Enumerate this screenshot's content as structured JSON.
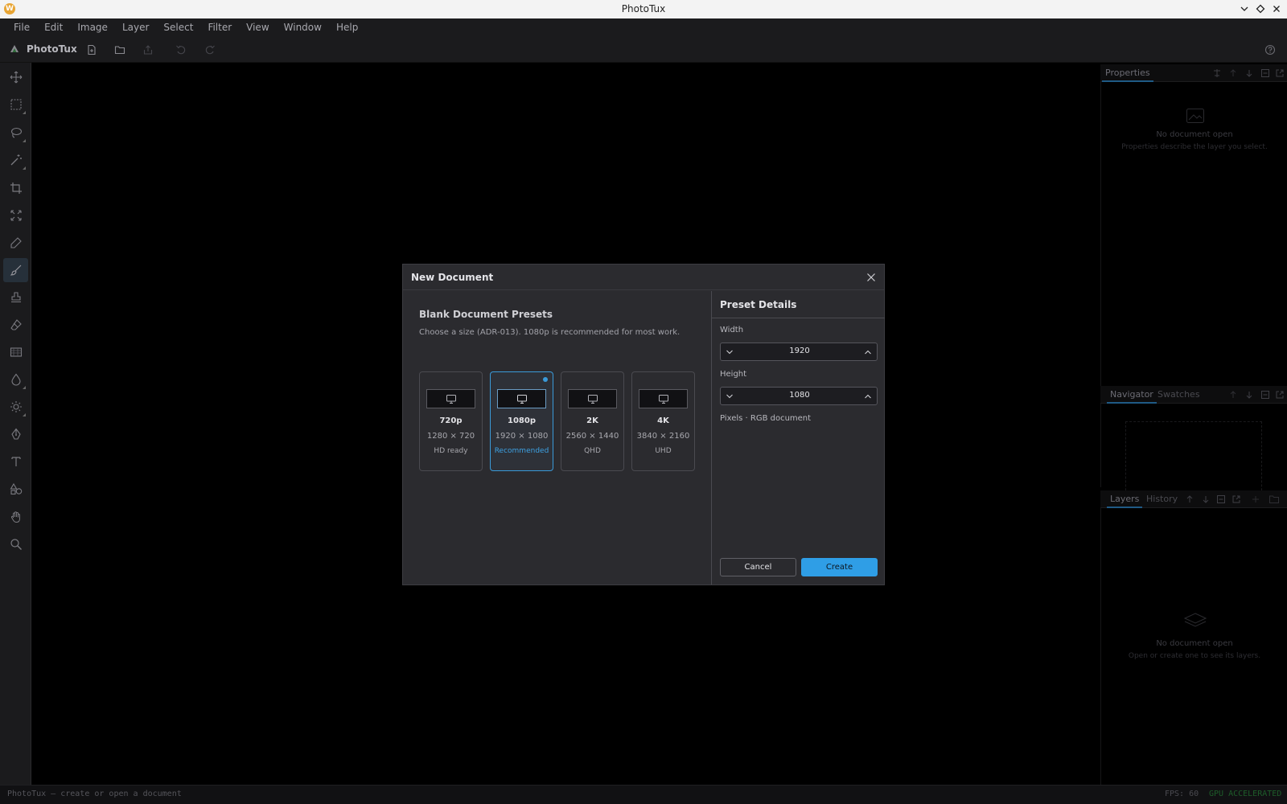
{
  "window": {
    "title": "PhotoTux",
    "logo_letter": "W"
  },
  "menu": [
    "File",
    "Edit",
    "Image",
    "Layer",
    "Select",
    "Filter",
    "View",
    "Window",
    "Help"
  ],
  "toolbar": {
    "brand": "PhotoTux"
  },
  "panels": {
    "properties": {
      "tab": "Properties",
      "empty_title": "No document open",
      "empty_sub": "Properties describe the layer you select."
    },
    "navigator": {
      "tabs": [
        "Navigator",
        "Swatches"
      ]
    },
    "layers": {
      "tabs": [
        "Layers",
        "History"
      ],
      "empty_title": "No document open",
      "empty_sub": "Open or create one to see its layers."
    }
  },
  "status": {
    "left": "PhotoTux — create or open a document",
    "fps": "FPS: 60",
    "gpu": "GPU ACCELERATED"
  },
  "dialog": {
    "title": "New Document",
    "presets_heading": "Blank Document Presets",
    "presets_desc": "Choose a size (ADR-013). 1080p is recommended for most work.",
    "presets": [
      {
        "name": "720p",
        "dims": "1280 × 720",
        "tag": "HD ready",
        "selected": false
      },
      {
        "name": "1080p",
        "dims": "1920 × 1080",
        "tag": "Recommended",
        "selected": true
      },
      {
        "name": "2K",
        "dims": "2560 × 1440",
        "tag": "QHD",
        "selected": false
      },
      {
        "name": "4K",
        "dims": "3840 × 2160",
        "tag": "UHD",
        "selected": false
      }
    ],
    "details": {
      "heading": "Preset Details",
      "width_label": "Width",
      "width_value": "1920",
      "height_label": "Height",
      "height_value": "1080",
      "note": "Pixels · RGB document"
    },
    "buttons": {
      "cancel": "Cancel",
      "create": "Create"
    }
  },
  "colors": {
    "accent": "#2f9ee6",
    "selected_border": "#3a9ad9"
  }
}
